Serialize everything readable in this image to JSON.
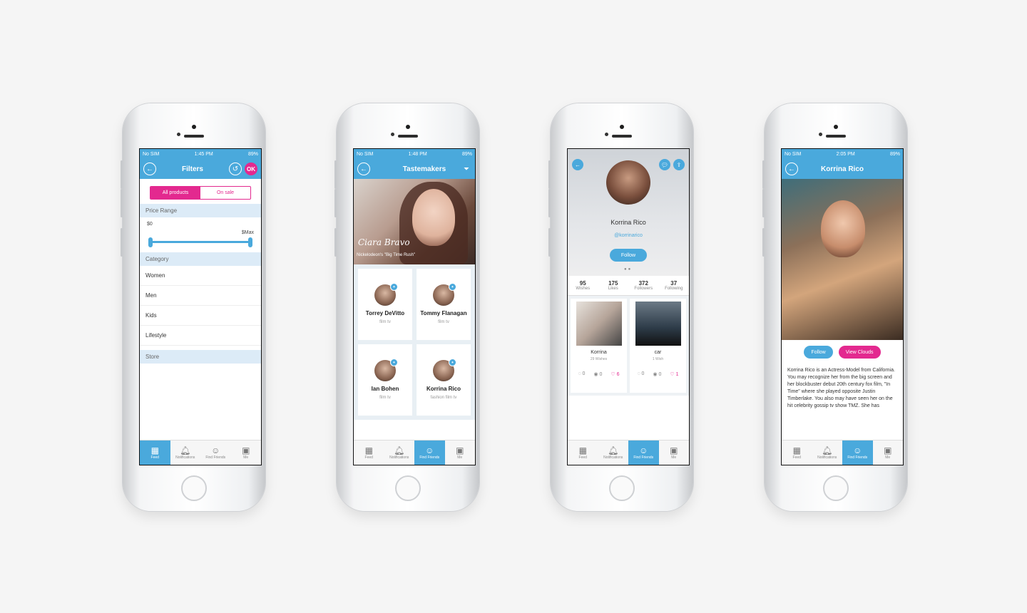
{
  "tabs": [
    "Feed",
    "Notifications",
    "Find Friends",
    "Me"
  ],
  "accent": "#4aa9dc",
  "brand_pink": "#e3298f",
  "filters": {
    "status": {
      "carrier": "No SIM",
      "time": "1:45 PM",
      "battery": "89%"
    },
    "title": "Filters",
    "ok": "OK",
    "segment": [
      "All products",
      "On sale"
    ],
    "price_range": "Price Range",
    "min": "$0",
    "max": "$Max",
    "category": "Category",
    "categories": [
      "Women",
      "Men",
      "Kids",
      "Lifestyle"
    ],
    "store": "Store",
    "active_tab": "Feed"
  },
  "tastemakers": {
    "status": {
      "carrier": "No SIM",
      "time": "1:48 PM",
      "battery": "89%"
    },
    "title": "Tastemakers",
    "hero_name": "Ciara Bravo",
    "hero_sub": "Nickelodeon's \"Big Time Rush\"",
    "cards": [
      {
        "name": "Torrey DeVitto",
        "tags": "film tv"
      },
      {
        "name": "Tommy Flanagan",
        "tags": "film tv"
      },
      {
        "name": "Ian Bohen",
        "tags": "film tv"
      },
      {
        "name": "Korrina Rico",
        "tags": "fashion film tv"
      }
    ],
    "active_tab": "Find Friends"
  },
  "profile": {
    "name": "Korrina Rico",
    "handle": "@korrinarico",
    "follow": "Follow",
    "stats": [
      {
        "num": "95",
        "label": "Wishes"
      },
      {
        "num": "175",
        "label": "Likes"
      },
      {
        "num": "372",
        "label": "Followers"
      },
      {
        "num": "37",
        "label": "Following"
      }
    ],
    "wishes": [
      {
        "name": "Korrina",
        "sub": "29 Wishes",
        "counts": [
          "0",
          "0",
          "6"
        ]
      },
      {
        "name": "car",
        "sub": "1 Wish",
        "counts": [
          "0",
          "0",
          "1"
        ]
      }
    ],
    "active_tab": "Find Friends"
  },
  "detail": {
    "status": {
      "carrier": "No SIM",
      "time": "2:05 PM",
      "battery": "89%"
    },
    "title": "Korrina Rico",
    "follow": "Follow",
    "view_clouds": "View Clouds",
    "bio": "Korrina Rico is an Actress-Model from California. You may recognize her from the big screen and her blockbuster debut 20th century fox film, \"In Time\" where she played opposite Justin Timberlake. You also may have seen her on the hit celebrity gossip tv show TMZ. She has",
    "active_tab": "Find Friends"
  }
}
